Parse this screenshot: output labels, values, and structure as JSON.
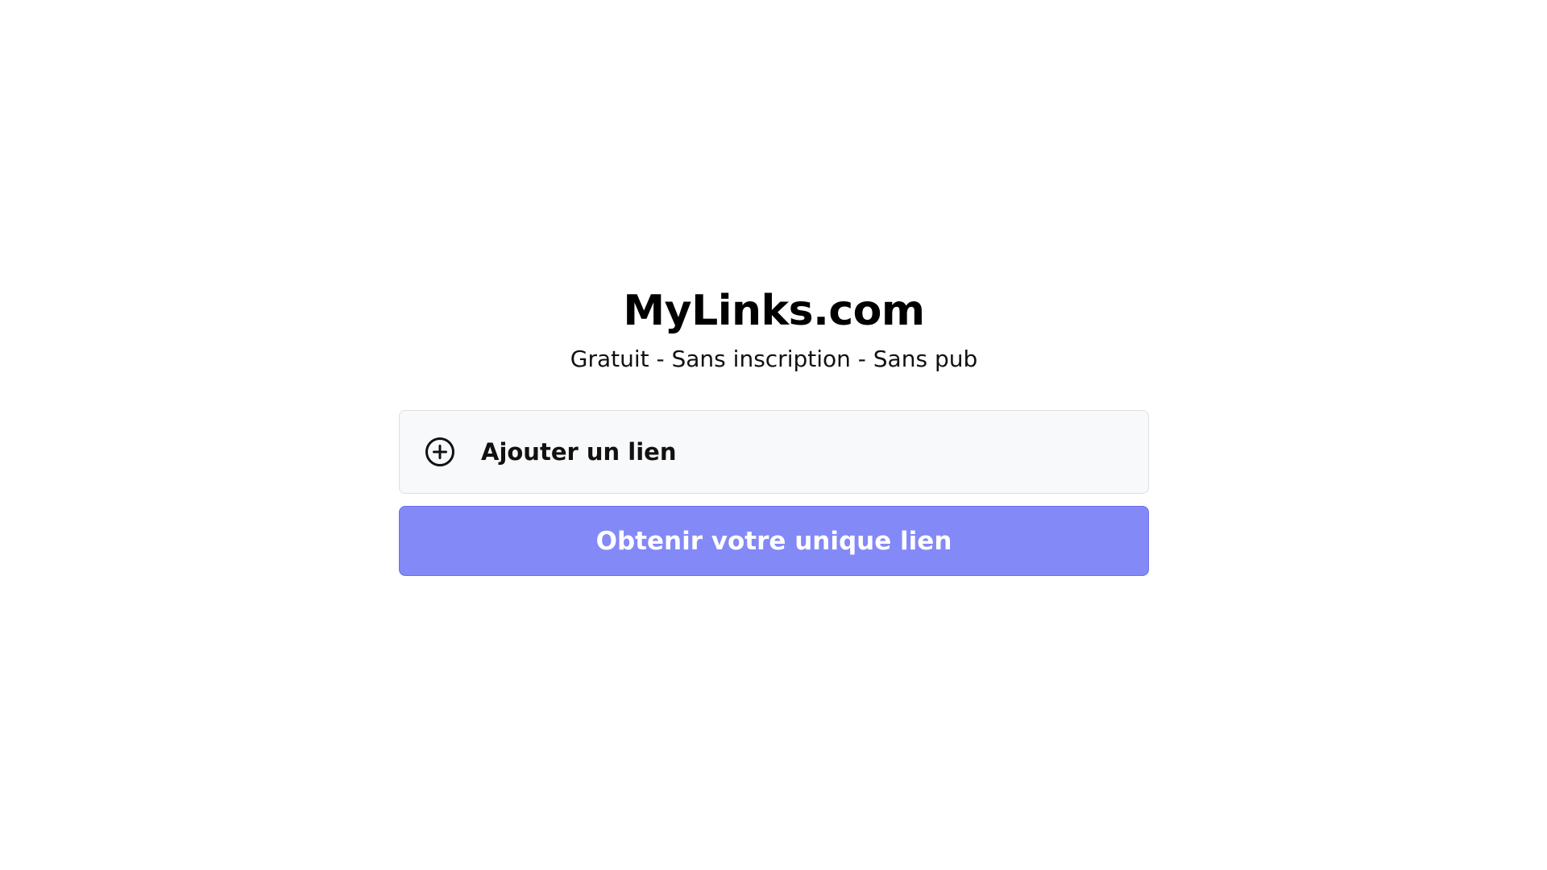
{
  "header": {
    "title": "MyLinks.com",
    "tagline": "Gratuit - Sans inscription - Sans pub"
  },
  "actions": {
    "add_link_label": "Ajouter un lien",
    "add_link_icon": "plus-circle-icon",
    "get_link_label": "Obtenir votre unique lien"
  },
  "colors": {
    "primary_button_bg": "#8389f7",
    "primary_button_border": "#6b6ff0",
    "add_link_bg": "#f8f9fa",
    "text": "#111111"
  }
}
